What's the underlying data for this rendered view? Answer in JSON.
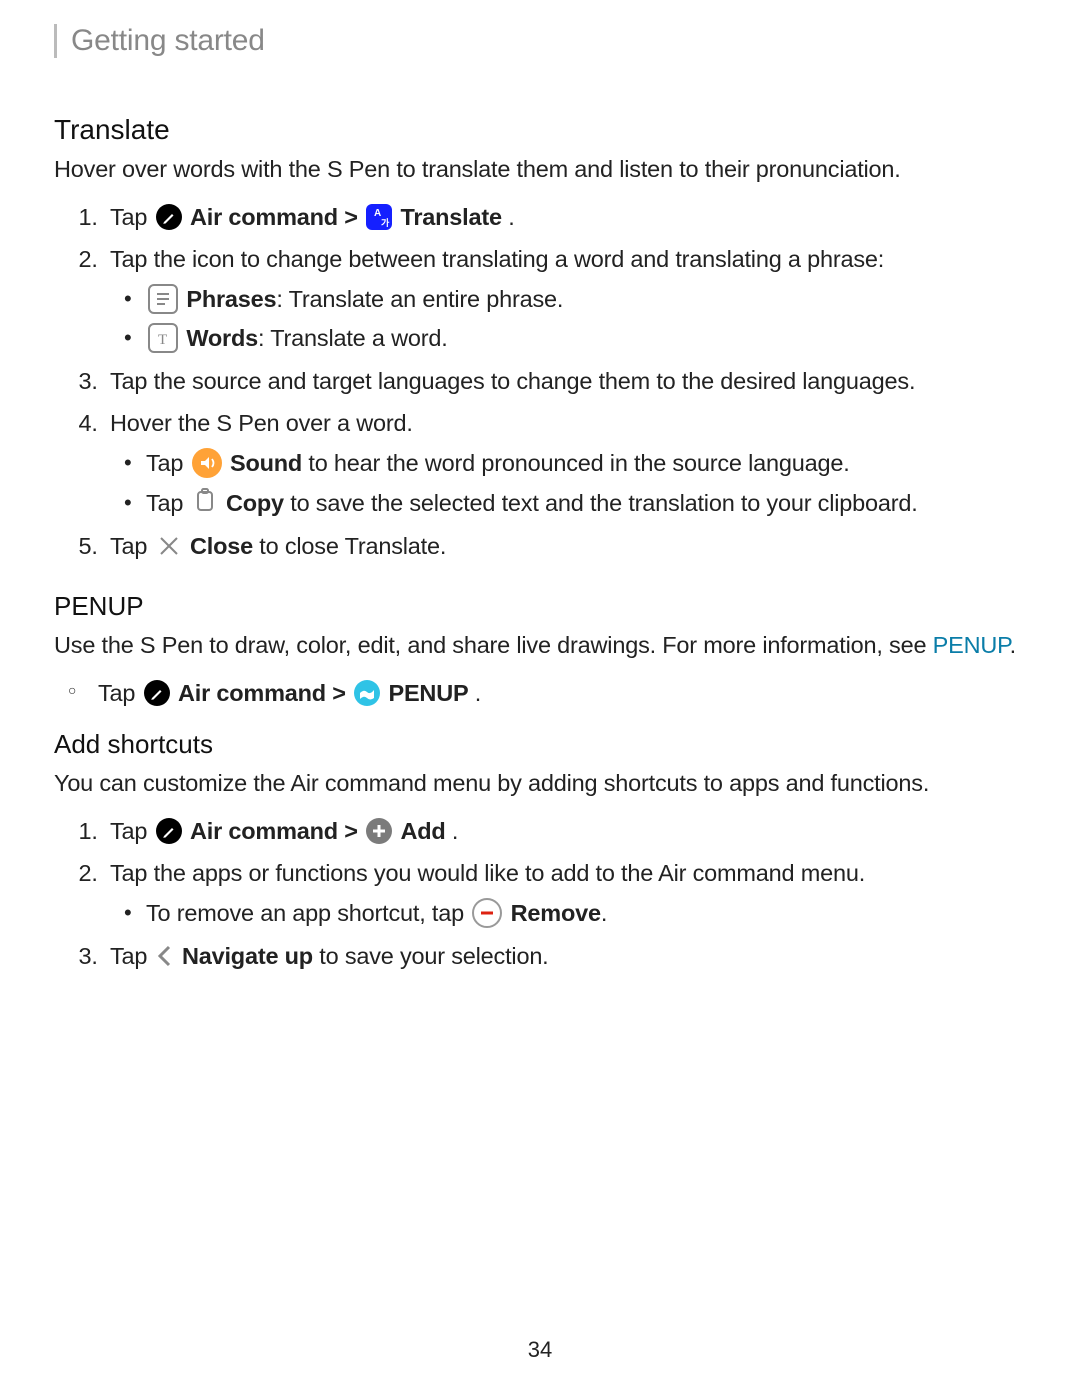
{
  "header": {
    "breadcrumb": "Getting started"
  },
  "translate": {
    "heading": "Translate",
    "intro": "Hover over words with the S Pen to translate them and listen to their pronunciation.",
    "step1_pre": "Tap ",
    "step1_cmd": " Air command",
    "step1_gt": " > ",
    "step1_trans": " Translate",
    "period": ".",
    "step2": "Tap the icon to change between translating a word and translating a phrase:",
    "step2a_b": "Phrases",
    "step2a_t": ": Translate an entire phrase.",
    "step2b_b": "Words",
    "step2b_t": ": Translate a word.",
    "step3": "Tap the source and target languages to change them to the desired languages.",
    "step4": "Hover the S Pen over a word.",
    "step4a_pre": "Tap ",
    "step4a_b": " Sound",
    "step4a_t": " to hear the word pronounced in the source language.",
    "step4b_pre": "Tap ",
    "step4b_b": " Copy",
    "step4b_t": " to save the selected text and the translation to your clipboard.",
    "step5_pre": "Tap ",
    "step5_b": " Close",
    "step5_t": " to close Translate."
  },
  "penup": {
    "heading": "PENUP",
    "intro_a": "Use the S Pen to draw, color, edit, and share live drawings. For more information, see ",
    "intro_link": "PENUP",
    "bullet_pre": "Tap ",
    "bullet_cmd": " Air command",
    "bullet_gt": " > ",
    "bullet_app": " PENUP"
  },
  "shortcuts": {
    "heading": "Add shortcuts",
    "intro": "You can customize the Air command menu by adding shortcuts to apps and functions.",
    "step1_pre": "Tap ",
    "step1_cmd": " Air command",
    "step1_gt": " > ",
    "step1_add": " Add",
    "step2": "Tap the apps or functions you would like to add to the Air command menu.",
    "step2a_pre": "To remove an app shortcut, tap ",
    "step2a_b": " Remove",
    "step3_pre": "Tap ",
    "step3_b": " Navigate up",
    "step3_t": " to save your selection."
  },
  "page_number": "34"
}
